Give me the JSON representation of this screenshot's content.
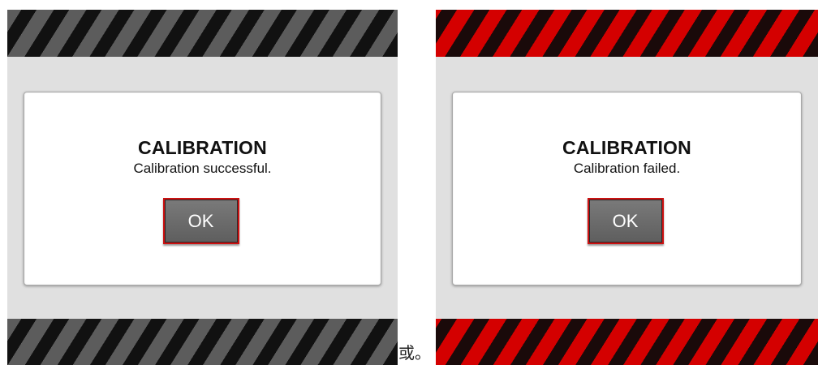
{
  "screens": {
    "success": {
      "title": "CALIBRATION",
      "message": "Calibration successful.",
      "ok_label": "OK",
      "stripe_colors": [
        "#111111",
        "#5c5c5c"
      ]
    },
    "failed": {
      "title": "CALIBRATION",
      "message": "Calibration failed.",
      "ok_label": "OK",
      "stripe_colors": [
        "#1a0a0a",
        "#d40000"
      ]
    }
  },
  "separator_text": "或。",
  "colors": {
    "panel_background": "#e0e0e0",
    "dialog_background": "#ffffff",
    "button_background": "#6b6b6b",
    "button_border": "#cc1111"
  }
}
